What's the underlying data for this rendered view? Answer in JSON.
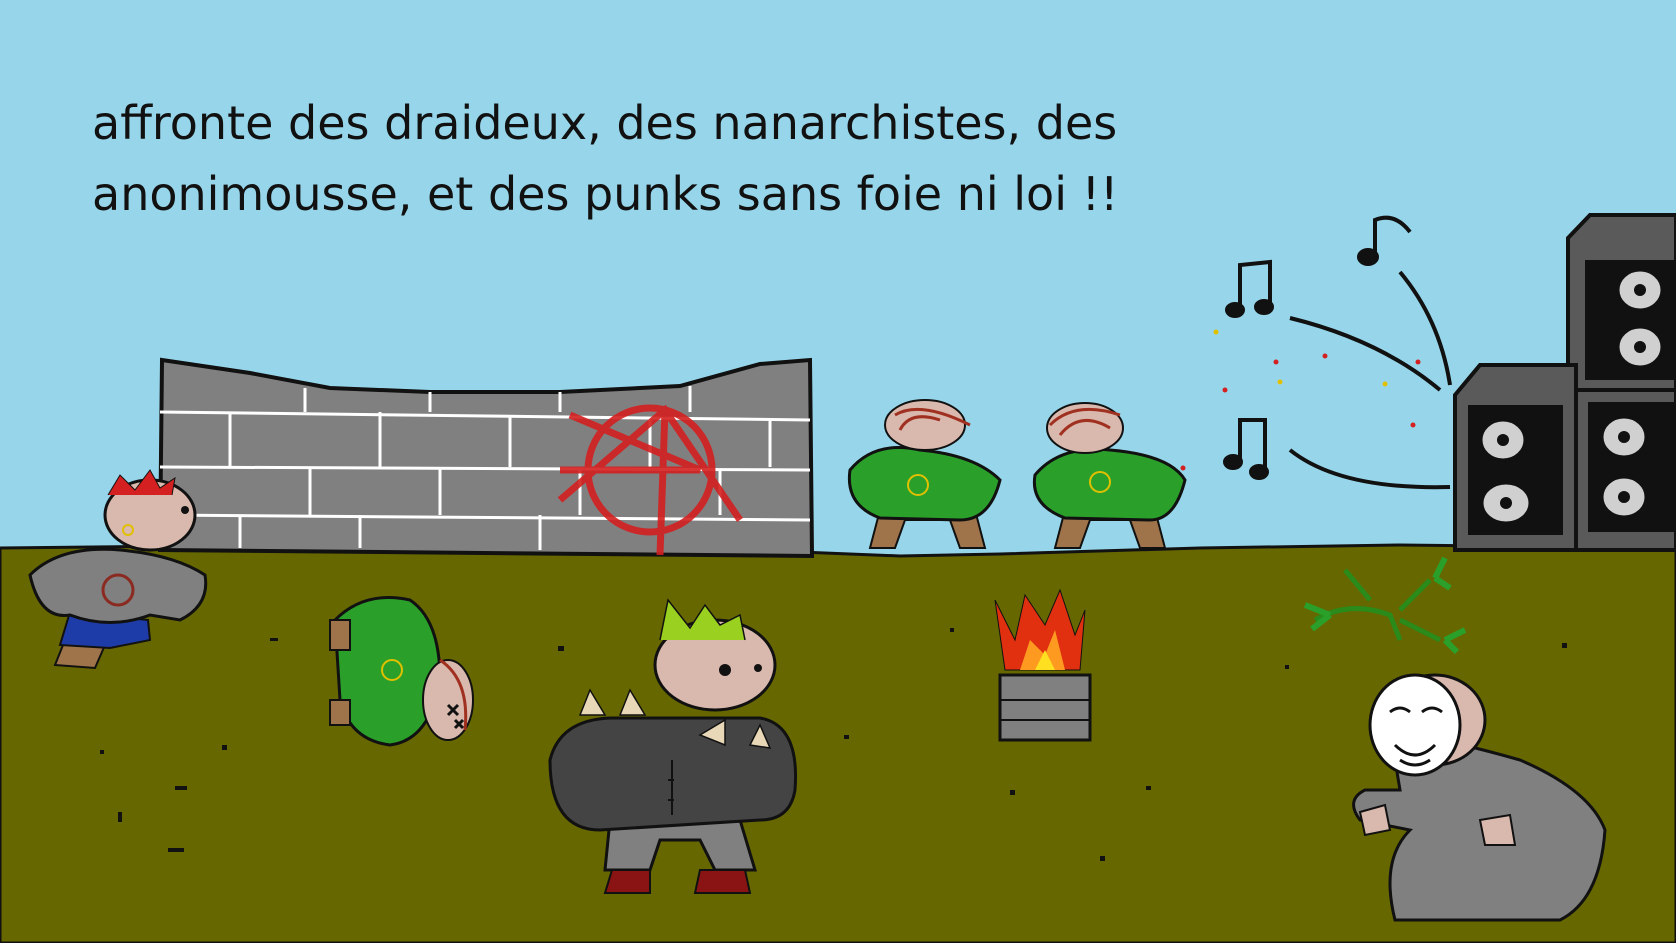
{
  "caption": {
    "line1": "affronte des draideux, des nanarchistes, des",
    "line2": "anonimousse, et des punks sans foie ni loi !!"
  },
  "colors": {
    "sky": "#97d6ea",
    "ground": "#676700",
    "wall": "#808080",
    "graffiti": "#d42020",
    "hoodie_green": "#2aa02a",
    "skin": "#d9b8ad",
    "speaker": "#5a5a5a"
  },
  "characters": [
    {
      "name": "punk with red mohawk",
      "icon": "punk-icon"
    },
    {
      "name": "dreadlock hippie knocked out",
      "icon": "knocked-out-icon"
    },
    {
      "name": "spiky punk",
      "icon": "spiky-punk-icon"
    },
    {
      "name": "two dreadlock hippies",
      "icon": "hippie-icon"
    },
    {
      "name": "anonymous mask wearer",
      "icon": "mask-icon"
    }
  ]
}
